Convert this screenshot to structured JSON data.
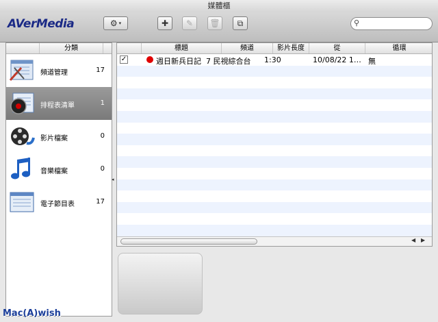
{
  "window": {
    "title": "媒體櫃"
  },
  "toolbar": {
    "logo": "AVerMedia",
    "gear_icon": "gear-icon",
    "add_icon": "plus-icon",
    "edit_icon": "edit-icon",
    "delete_icon": "trash-icon",
    "export_icon": "export-icon",
    "search_icon": "search-icon",
    "search_value": ""
  },
  "sidebar": {
    "header": "分類",
    "items": [
      {
        "label": "頻道管理",
        "count": "17",
        "icon": "channel-manage-icon"
      },
      {
        "label": "排程表清單",
        "count": "1",
        "icon": "schedule-list-icon",
        "selected": true
      },
      {
        "label": "影片檔案",
        "count": "0",
        "icon": "video-file-icon"
      },
      {
        "label": "音樂檔案",
        "count": "0",
        "icon": "music-file-icon"
      },
      {
        "label": "電子節目表",
        "count": "17",
        "icon": "epg-icon"
      }
    ]
  },
  "table": {
    "columns": [
      "標題",
      "頻道",
      "影片長度",
      "從",
      "循環"
    ],
    "rows": [
      {
        "checked": true,
        "status_icon": "record-dot-icon",
        "title": "週日新兵日記",
        "channel": "7 民視綜合台",
        "length": "1:30",
        "from": "10/08/22 1…",
        "repeat": "無"
      }
    ]
  },
  "watermark": "Mac(A)wish",
  "colors": {
    "selection": "#8a8a8a",
    "alt_row": "#edf3fe",
    "record": "#e00000",
    "logo": "#1b2a86"
  }
}
